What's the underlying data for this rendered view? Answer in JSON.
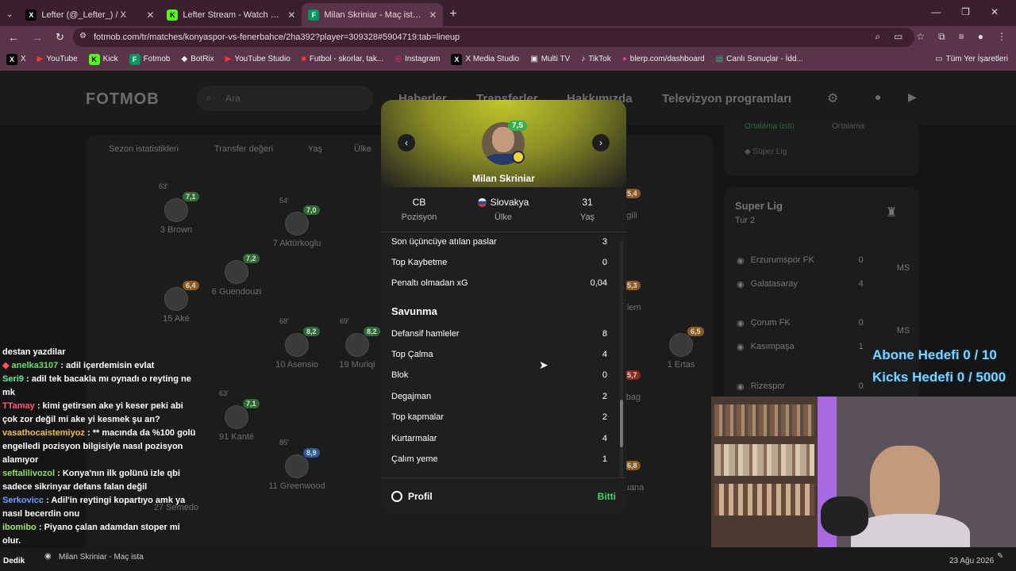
{
  "browser": {
    "tabs": [
      {
        "label": "Lefter (@_Lefter_) / X",
        "icon": "x-icon",
        "color": "#000000"
      },
      {
        "label": "Lefter Stream - Watch Live on Kick",
        "icon": "kick-icon",
        "color": "#53fc18"
      },
      {
        "label": "Milan Skriniar - Maç istatistikleri",
        "icon": "fotmob-icon",
        "color": "#00985f"
      }
    ],
    "url": "fotmob.com/tr/matches/konyaspor-vs-fenerbahce/2ha392?player=309328#5904719:tab=lineup",
    "bookmarks": [
      "X",
      "YouTube",
      "Kick",
      "Fotmob",
      "BotRix",
      "YouTube Studio",
      "Futbol - skorlar, tak...",
      "Instagram",
      "X Media Studio",
      "Multi TV",
      "TikTok",
      "blerp.com/dashboard",
      "Canlı Sonuçlar - İdd..."
    ],
    "all_bookmarks": "Tüm Yer İşaretleri"
  },
  "site": {
    "logo": "FOTMOB",
    "search_placeholder": "Ara",
    "nav": [
      "Haberler",
      "Transferler",
      "Hakkımızda",
      "Televizyon programları"
    ],
    "pitch_tabs": [
      "Sezon istatistikleri",
      "Transfer değeri",
      "Yaş",
      "Ülke"
    ],
    "players": [
      {
        "name": "3 Brown",
        "rating": "7,1",
        "minute": "63'"
      },
      {
        "name": "7 Aktürkoglu",
        "rating": "7,0",
        "minute": "54'"
      },
      {
        "name": "6 Guendouzi",
        "rating": "7,2",
        "minute": ""
      },
      {
        "name": "15 Aké",
        "rating": "6,4",
        "minute": ""
      },
      {
        "name": "10 Asensio",
        "rating": "8,2",
        "minute": "68'"
      },
      {
        "name": "19 Muriqi",
        "rating": "8,2",
        "minute": "69'"
      },
      {
        "name": "91 Kanté",
        "rating": "7,1",
        "minute": "63'"
      },
      {
        "name": "11 Greenwood",
        "rating": "8,9",
        "minute": "85'"
      },
      {
        "name": "1 Ertas",
        "rating": "6,5",
        "minute": ""
      },
      {
        "name": "27 Semedo",
        "rating": "",
        "minute": ""
      },
      {
        "name": "gili",
        "rating": "5,4",
        "minute": ""
      },
      {
        "name": "ziem",
        "rating": "5,3",
        "minute": ""
      },
      {
        "name": "rbag",
        "rating": "5,7",
        "minute": ""
      },
      {
        "name": "ouana",
        "rating": "6,8",
        "minute": ""
      }
    ],
    "side_top": {
      "tabs": [
        "Ortalama üstü",
        "Ortalama"
      ],
      "league": "Süper Lig"
    },
    "league_card": {
      "title": "Super Lig",
      "round": "Tur 2",
      "matches": [
        {
          "team": "Erzurumspor FK",
          "score": "0",
          "status": "MS"
        },
        {
          "team": "Galatasaray",
          "score": "4",
          "status": ""
        },
        {
          "team": "Çorum FK",
          "score": "0",
          "status": "MS"
        },
        {
          "team": "Kasımpaşa",
          "score": "1",
          "status": ""
        },
        {
          "team": "Rizespor",
          "score": "0",
          "status": ""
        }
      ]
    }
  },
  "modal": {
    "rating": "7,5",
    "name": "Milan Skriniar",
    "position": {
      "value": "CB",
      "label": "Pozisyon"
    },
    "country": {
      "value": "Slovakya",
      "label": "Ülke"
    },
    "age": {
      "value": "31",
      "label": "Yaş"
    },
    "stats_top": [
      {
        "label": "Son üçüncüye atılan paslar",
        "value": "3"
      },
      {
        "label": "Top Kaybetme",
        "value": "0"
      },
      {
        "label": "Penaltı olmadan xG",
        "value": "0,04"
      }
    ],
    "section": "Savunma",
    "stats_def": [
      {
        "label": "Defansif hamleler",
        "value": "8"
      },
      {
        "label": "Top Çalma",
        "value": "4"
      },
      {
        "label": "Blok",
        "value": "0"
      },
      {
        "label": "Degajman",
        "value": "2"
      },
      {
        "label": "Top kapmalar",
        "value": "2"
      },
      {
        "label": "Kurtarmalar",
        "value": "4"
      },
      {
        "label": "Çalım yeme",
        "value": "1"
      }
    ],
    "profile": "Profil",
    "done": "Bitti"
  },
  "chat": [
    {
      "user": "",
      "text": "destan yazdilar"
    },
    {
      "user": "anelka3107",
      "text": "adil içerdemisin evlat"
    },
    {
      "user": "Seri9",
      "text": "adil tek bacakla mı oynadı o reyting ne mk"
    },
    {
      "user": "TTamay",
      "text": "kimi getirsen ake yi keser peki abi çok zor değil mi ake yi kesmek şu an?"
    },
    {
      "user": "vasathocaistemiyoz",
      "text": "** macında da %100 golü engelledi pozisyon bilgisiyle nasıl pozisyon alamıyor"
    },
    {
      "user": "seftalilivozol",
      "text": "Konya'nın ilk golünü izle qbi sadece sikrinyar defans falan değil"
    },
    {
      "user": "Serkovicc",
      "text": "Adil'in reytingi kopartıyo amk ya nasıl becerdin onu"
    },
    {
      "user": "ibomibo",
      "text": "Piyano çalan adamdan stoper mi olur."
    }
  ],
  "overlay": {
    "sub_goal": "Abone Hedefi 0 / 10",
    "kick_goal": "Kicks Hedefi 0 / 5000"
  },
  "taskbar": {
    "app": "Milan Skriniar - Maç ista",
    "date": "23 Ağu 2026",
    "left": "Dedik"
  }
}
